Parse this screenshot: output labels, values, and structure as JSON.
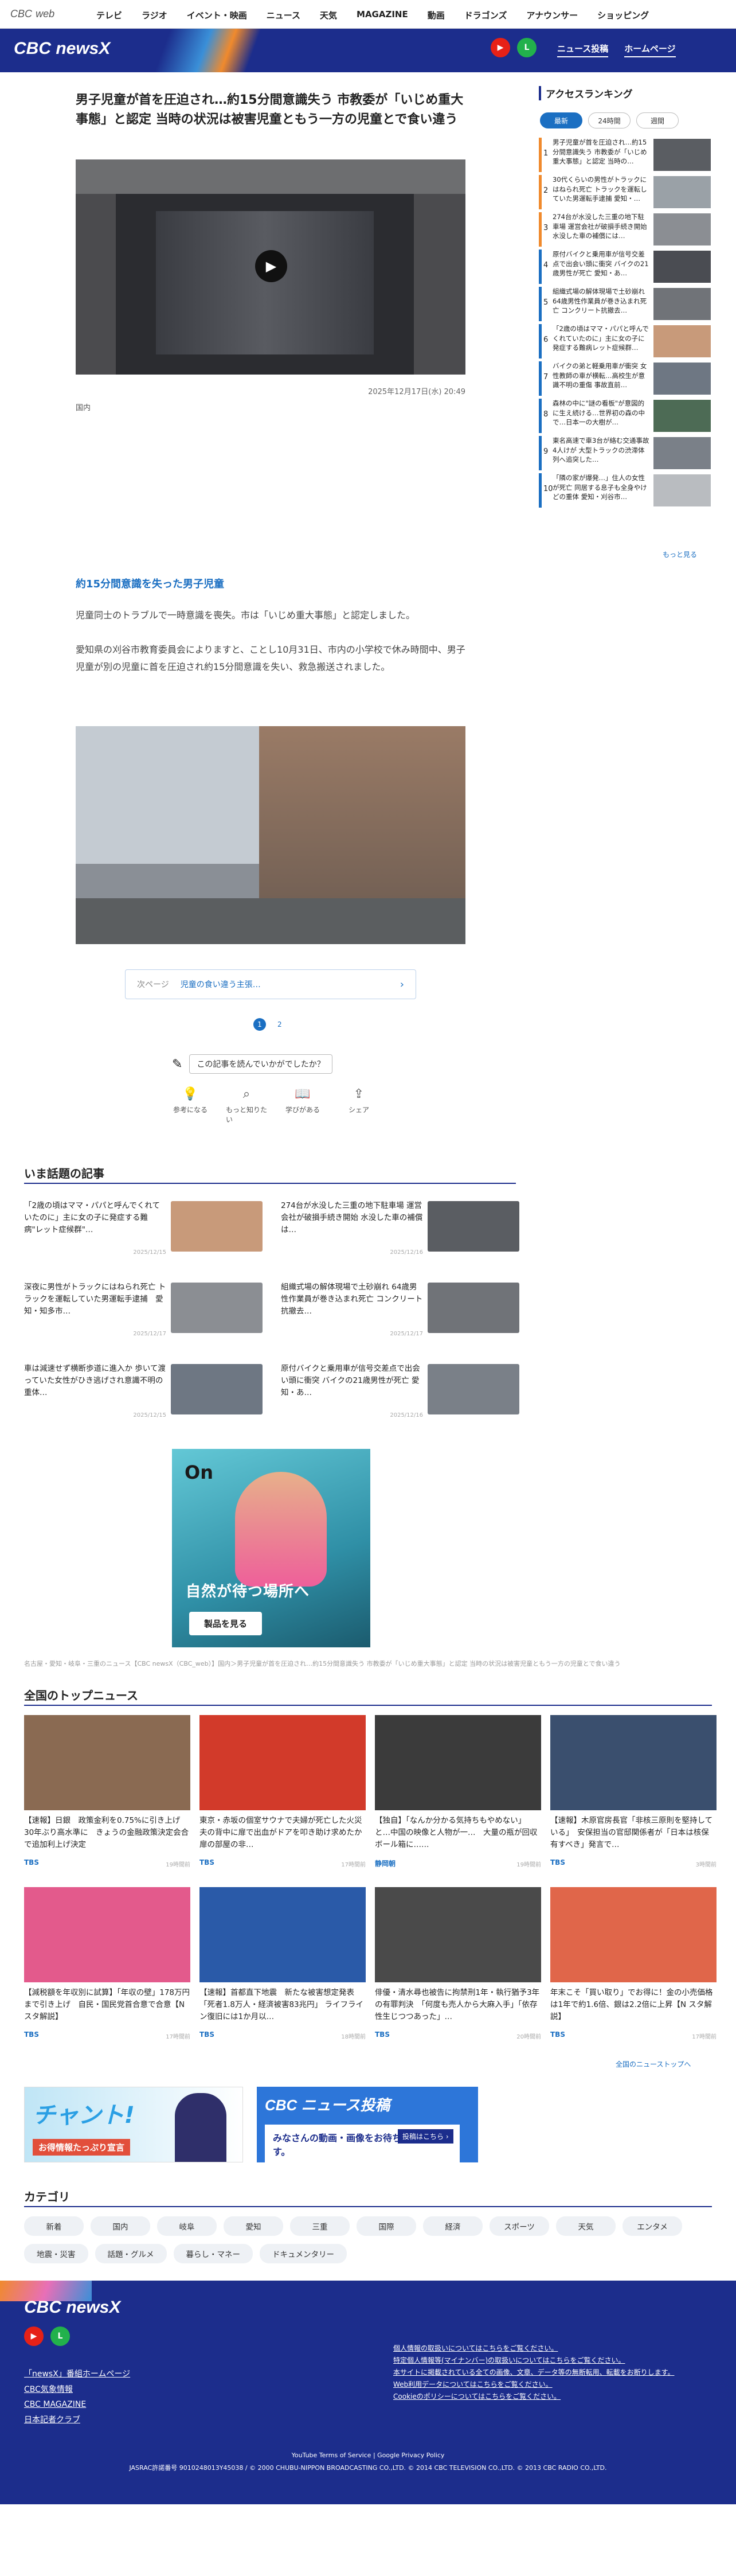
{
  "site": {
    "brand_small": "CBC",
    "brand_small_suffix": "web",
    "brand_main": "CBC newsX"
  },
  "topnav": [
    "テレビ",
    "ラジオ",
    "イベント・映画",
    "ニュース",
    "天気",
    "MAGAZINE",
    "動画",
    "ドラゴンズ",
    "アナウンサー",
    "ショッピング"
  ],
  "header_links": {
    "post": "ニュース投稿",
    "home": "ホームページ"
  },
  "article": {
    "title": "男子児童が首を圧迫され…約15分間意識失う 市教委が「いじめ重大事態」と認定 当時の状況は被害児童ともう一方の児童とで食い違う",
    "date": "2025年12月17日(水) 20:49",
    "category": "国内",
    "subheading": "約15分間意識を失った男子児童",
    "para1": "児童同士のトラブルで一時意識を喪失。市は「いじめ重大事態」と認定しました。",
    "para2": "愛知県の刈谷市教育委員会によりますと、ことし10月31日、市内の小学校で休み時間中、男子児童が別の児童に首を圧迫され約15分間意識を失い、救急搬送されました。",
    "next_label": "次ページ",
    "next_text": "児童の食い違う主張…",
    "pages": [
      "1",
      "2"
    ],
    "feedback_q": "この記事を読んでいかがでしたか？",
    "reactions": [
      "参考になる",
      "もっと知りたい",
      "学びがある",
      "シェア"
    ]
  },
  "ranking": {
    "title": "アクセスランキング",
    "tabs": [
      "最新",
      "24時間",
      "週間"
    ],
    "more": "もっと見る",
    "items": [
      {
        "num": "1",
        "text": "男子児童が首を圧迫され…約15分間意識失う 市教委が「いじめ重大事態」と認定 当時の…",
        "color": "#f08a2d"
      },
      {
        "num": "2",
        "text": "30代くらいの男性がトラックにはねられ死亡 トラックを運転していた男運転手逮捕 愛知・…",
        "color": "#f08a2d"
      },
      {
        "num": "3",
        "text": "274台が水没した三重の地下駐車場 運営会社が破損手続き開始 水没した車の補償には…",
        "color": "#f08a2d"
      },
      {
        "num": "4",
        "text": "原付バイクと乗用車が信号交差点で出会い頭に衝突 バイクの21歳男性が死亡 愛知・あ…",
        "color": "#1b6fc2"
      },
      {
        "num": "5",
        "text": "組織式場の解体現場で土砂崩れ 64歳男性作業員が巻き込まれ死亡 コンクリート抗撤去…",
        "color": "#1b6fc2"
      },
      {
        "num": "6",
        "text": "「2歳の頃はママ・パパと呼んでくれていたのに」主に女の子に発症する難病レット症候群…",
        "color": "#1b6fc2"
      },
      {
        "num": "7",
        "text": "バイクの弟と軽乗用車が衝突 女性教師の車が横転…高校生が意識不明の重傷 事故直前…",
        "color": "#1b6fc2"
      },
      {
        "num": "8",
        "text": "森林の中に\"謎の看板\"が意図的に生え続ける…世界初の森の中で…日本一の大樹が…",
        "color": "#1b6fc2"
      },
      {
        "num": "9",
        "text": "東名高速で車3台が絡む交通事故 4人けが 大型トラックの渋滞体列へ追突した…",
        "color": "#1b6fc2"
      },
      {
        "num": "10",
        "text": "「隣の家が爆発…」住人の女性が死亡 同居する息子も全身やけどの重体 愛知・刈谷市…",
        "color": "#1b6fc2"
      }
    ]
  },
  "trending": {
    "title": "いま話題の記事",
    "items": [
      {
        "text": "「2歳の頃はママ・パパと呼んでくれていたのに」主に女の子に発症する難病\"レット症候群\"…",
        "date": "2025/12/15"
      },
      {
        "text": "274台が水没した三重の地下駐車場 運営会社が破損手続き開始 水没した車の補償は…",
        "date": "2025/12/16"
      },
      {
        "text": "深夜に男性がトラックにはねられ死亡 トラックを運転していた男運転手逮捕　愛知・知多市…",
        "date": "2025/12/17"
      },
      {
        "text": "組織式場の解体現場で土砂崩れ 64歳男性作業員が巻き込まれ死亡 コンクリート抗撤去…",
        "date": "2025/12/17"
      },
      {
        "text": "車は減速せず横断歩道に進入か 歩いて渡っていた女性がひき逃げされ意識不明の重体…",
        "date": "2025/12/15"
      },
      {
        "text": "原付バイクと乗用車が信号交差点で出会い頭に衝突 バイクの21歳男性が死亡 愛知・あ…",
        "date": "2025/12/16"
      }
    ]
  },
  "ad": {
    "logo": "On",
    "text": "自然が待つ場所へ",
    "button": "製品を見る"
  },
  "breadcrumb": "名古屋・愛知・岐阜・三重のニュース【CBC newsX（CBC_web）】国内＞男子児童が首を圧迫され…約15分間意識失う 市教委が「いじめ重大事態」と認定 当時の状況は被害児童ともう一方の児童とで食い違う",
  "top_news": {
    "title": "全国のトップニュース",
    "more": "全国のニューストップへ",
    "items": [
      {
        "text": "【速報】日銀　政策金利を0.75%に引き上げ　30年ぶり高水準に　きょうの金融政策決定会合で追加利上げ決定",
        "src": "TBS",
        "date": "19時間前"
      },
      {
        "text": "東京・赤坂の個室サウナで夫婦が死亡した火災　夫の背中に扉で出血がドアを叩き助け求めたか　　扉の部屋の非…",
        "src": "TBS",
        "date": "17時間前"
      },
      {
        "text": "【独自】「なんか分かる気持ちもやめない」と…中国の映像と人物が一…　大量の瓶が回収ボール箱に……",
        "src": "静岡朝",
        "date": "19時間前"
      },
      {
        "text": "【速報】木原官房長官「非核三原則を堅持している」　安保担当の官邸関係者が「日本は核保有すべき」発言で…",
        "src": "TBS",
        "date": "3時間前"
      },
      {
        "text": "【減税額を年収別に試算】「年収の壁」178万円まで引き上げ　自民・国民党首合意で合意【N スタ解説】",
        "src": "TBS",
        "date": "17時間前"
      },
      {
        "text": "【速報】首都直下地震　新たな被害想定発表「死者1.8万人・経済被害83兆円」 ライフライン復旧には1か月以…",
        "src": "TBS",
        "date": "18時間前"
      },
      {
        "text": "俳優・清水尋也被告に拘禁刑1年・執行猶予3年の有罪判決　「何度も売人から大麻入手」「依存性生じつつあった」…",
        "src": "TBS",
        "date": "20時間前"
      },
      {
        "text": "年末こそ「買い取り」でお得に！金の小売価格は1年で約1.6倍、銀は2.2倍に上昇【N スタ解説】",
        "src": "TBS",
        "date": "17時間前"
      }
    ]
  },
  "banners": {
    "b1_title": "チャント!",
    "b1_sub": "お得情報たっぷり宣言",
    "b2_title": "CBC ニュース投稿",
    "b2_text": "みなさんの動画・画像をお待ちしています。",
    "b2_btn": "投稿はこちら ›"
  },
  "categories": {
    "title": "カテゴリ",
    "items": [
      "新着",
      "国内",
      "岐阜",
      "愛知",
      "三重",
      "国際",
      "経済",
      "スポーツ",
      "天気",
      "エンタメ",
      "地震・災害",
      "話題・グルメ",
      "暮らし・マネー",
      "ドキュメンタリー"
    ]
  },
  "footer": {
    "links": [
      "「newsX」番組ホームページ",
      "CBC気象情報",
      "CBC MAGAZINE",
      "日本記者クラブ"
    ],
    "policies": [
      "個人情報の取扱いについてはこちらをご覧ください。",
      "特定個人情報等(マイナンバー)の取扱いについてはこちらをご覧ください。",
      "本サイトに掲載されている全ての画像、文章、データ等の無断転用、転載をお断りします。",
      "Web利用データについてはこちらをご覧ください。",
      "Cookieのポリシーについてはこちらをご覧ください。"
    ],
    "terms": "YouTube Terms of Service | Google Privacy Policy",
    "copyright": "JASRAC許諾番号 9010248013Y45038 / © 2000 CHUBU-NIPPON BROADCASTING CO.,LTD. © 2014 CBC TELEVISION CO.,LTD. © 2013 CBC RADIO CO.,LTD."
  }
}
